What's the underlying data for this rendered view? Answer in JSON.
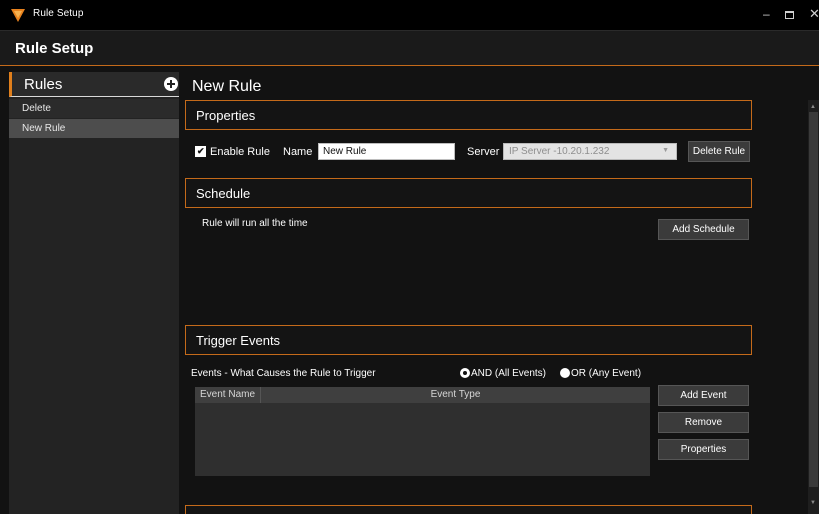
{
  "window": {
    "title": "Rule Setup",
    "controls": {
      "minimize": "–",
      "close": "✕"
    }
  },
  "header": {
    "title": "Rule Setup"
  },
  "sidebar": {
    "title": "Rules",
    "items": [
      {
        "label": "Delete"
      },
      {
        "label": "New Rule"
      }
    ]
  },
  "main": {
    "title": "New Rule",
    "properties": {
      "section_label": "Properties",
      "enable_checked": true,
      "enable_label": "Enable Rule",
      "name_label": "Name",
      "name_value": "New Rule",
      "server_label": "Server",
      "server_value": "IP Server -10.20.1.232",
      "delete_rule_label": "Delete Rule"
    },
    "schedule": {
      "section_label": "Schedule",
      "text": "Rule will run all the time",
      "add_schedule_label": "Add Schedule"
    },
    "trigger": {
      "section_label": "Trigger Events",
      "events_label": "Events - What Causes the Rule to Trigger",
      "options": [
        {
          "label": "AND (All Events)",
          "selected": true
        },
        {
          "label": "OR (Any Event)",
          "selected": false
        }
      ],
      "columns": [
        "Event Name",
        "Event Type"
      ],
      "rows": [],
      "buttons": {
        "add_event": "Add Event",
        "remove": "Remove",
        "properties": "Properties"
      }
    }
  },
  "colors": {
    "accent": "#e07f1c",
    "background": "#121212",
    "button": "#3b3b3b"
  },
  "icons": {
    "app": "shield-logo-icon",
    "add": "plus-circle-icon",
    "dropdown": "chevron-down-icon"
  }
}
